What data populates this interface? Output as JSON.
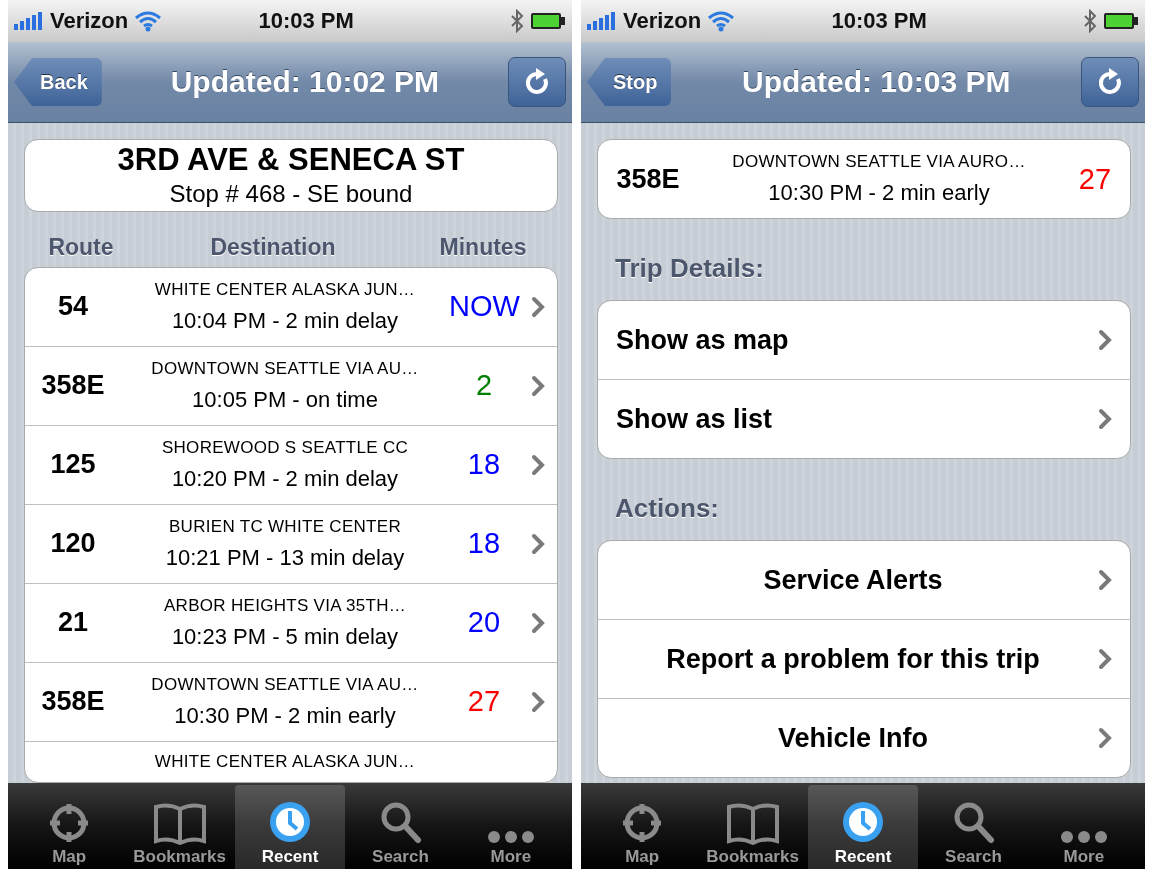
{
  "screens": [
    {
      "kind": "stop",
      "status_bar": {
        "carrier": "Verizon",
        "time": "10:03 PM"
      },
      "nav_bar": {
        "back_button": "Back",
        "title": "Updated: 10:02 PM"
      },
      "stop_card": {
        "name": "3RD AVE & SENECA ST",
        "detail": "Stop # 468 - SE bound"
      },
      "columns": [
        "Route",
        "Destination",
        "Minutes"
      ],
      "arrivals": [
        {
          "route": "54",
          "destination": "WHITE CENTER ALASKA JUN…",
          "time": "10:04 PM - 2 min delay",
          "minutes": "NOW",
          "color": "#0000ff"
        },
        {
          "route": "358E",
          "destination": "DOWNTOWN SEATTLE VIA AU…",
          "time": "10:05 PM - on time",
          "minutes": "2",
          "color": "#008000"
        },
        {
          "route": "125",
          "destination": "SHOREWOOD S SEATTLE CC",
          "time": "10:20 PM - 2 min delay",
          "minutes": "18",
          "color": "#0000ff"
        },
        {
          "route": "120",
          "destination": "BURIEN TC WHITE CENTER",
          "time": "10:21 PM - 13 min delay",
          "minutes": "18",
          "color": "#0000ff"
        },
        {
          "route": "21",
          "destination": "ARBOR HEIGHTS VIA 35TH…",
          "time": "10:23 PM - 5 min delay",
          "minutes": "20",
          "color": "#0000ff"
        },
        {
          "route": "358E",
          "destination": "DOWNTOWN SEATTLE VIA AU…",
          "time": "10:30 PM - 2 min early",
          "minutes": "27",
          "color": "#ff0000"
        },
        {
          "destination": "WHITE CENTER ALASKA JUN…"
        }
      ],
      "tab_bar": [
        {
          "label": "Map",
          "selected": false
        },
        {
          "label": "Bookmarks",
          "selected": false
        },
        {
          "label": "Recent",
          "selected": true
        },
        {
          "label": "Search",
          "selected": false
        },
        {
          "label": "More",
          "selected": false
        }
      ]
    },
    {
      "kind": "trip",
      "status_bar": {
        "carrier": "Verizon",
        "time": "10:03 PM"
      },
      "nav_bar": {
        "back_button": "Stop",
        "title": "Updated: 10:03 PM"
      },
      "arrival": {
        "route": "358E",
        "destination": "DOWNTOWN SEATTLE VIA AURO…",
        "time": "10:30 PM - 2 min early",
        "minutes": "27",
        "color": "#ff0000"
      },
      "sections": [
        {
          "title": "Trip Details:",
          "centered": false,
          "items": [
            "Show as map",
            "Show as list"
          ]
        },
        {
          "title": "Actions:",
          "centered": true,
          "items": [
            "Service Alerts",
            "Report a problem for this trip",
            "Vehicle Info"
          ]
        }
      ],
      "tab_bar": [
        {
          "label": "Map",
          "selected": false
        },
        {
          "label": "Bookmarks",
          "selected": false
        },
        {
          "label": "Recent",
          "selected": true
        },
        {
          "label": "Search",
          "selected": false
        },
        {
          "label": "More",
          "selected": false
        }
      ]
    }
  ]
}
